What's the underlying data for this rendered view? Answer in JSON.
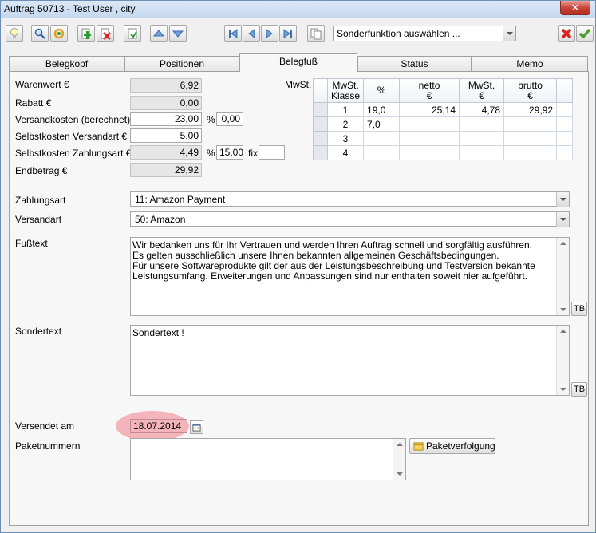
{
  "window": {
    "title": "Auftrag 50713 - Test User , city",
    "close_glyph": "✕"
  },
  "toolbar": {
    "sonderfunktion": "Sonderfunktion auswählen ...",
    "icons": [
      "bulb-icon",
      "search-icon",
      "refresh-icon",
      "add-icon",
      "delete-icon",
      "export-icon",
      "up-icon",
      "down-icon",
      "first-icon",
      "prev-icon",
      "next-icon",
      "last-icon",
      "copy-icon",
      "cancel-icon",
      "ok-icon"
    ]
  },
  "tabs": [
    "Belegkopf",
    "Positionen",
    "Belegfuß",
    "Status",
    "Memo"
  ],
  "active_tab": "Belegfuß",
  "amounts": {
    "warenwert_label": "Warenwert €",
    "warenwert": "6,92",
    "rabatt_label": "Rabatt €",
    "rabatt": "0,00",
    "versandkosten_label": "Versandkosten (berechnet) €",
    "versandkosten": "23,00",
    "versand_pct_label": "%",
    "versand_pct": "0,00",
    "selbst_versand_label": "Selbstkosten Versandart €",
    "selbst_versand": "5,00",
    "selbst_zahlung_label": "Selbstkosten Zahlungsart €",
    "selbst_zahlung": "4,49",
    "zahlung_pct_label": "%",
    "zahlung_pct": "15,00",
    "fix_label": "fix",
    "fix_value": "",
    "endbetrag_label": "Endbetrag €",
    "endbetrag": "29,92"
  },
  "mwst": {
    "label": "MwSt.",
    "headers": [
      {
        "line1": "MwSt.",
        "line2": "Klasse"
      },
      {
        "line1": "%",
        "line2": ""
      },
      {
        "line1": "netto",
        "line2": "€"
      },
      {
        "line1": "MwSt.",
        "line2": "€"
      },
      {
        "line1": "brutto",
        "line2": "€"
      }
    ],
    "rows": [
      {
        "klasse": "1",
        "pct": "19,0",
        "netto": "25,14",
        "mwst": "4,78",
        "brutto": "29,92"
      },
      {
        "klasse": "2",
        "pct": "7,0",
        "netto": "",
        "mwst": "",
        "brutto": ""
      },
      {
        "klasse": "3",
        "pct": "",
        "netto": "",
        "mwst": "",
        "brutto": ""
      },
      {
        "klasse": "4",
        "pct": "",
        "netto": "",
        "mwst": "",
        "brutto": ""
      }
    ]
  },
  "zahlungsart": {
    "label": "Zahlungsart",
    "value": "11: Amazon Payment"
  },
  "versandart": {
    "label": "Versandart",
    "value": "50: Amazon"
  },
  "fusstext": {
    "label": "Fußtext",
    "lines": [
      "Wir bedanken uns für Ihr Vertrauen und werden Ihren Auftrag schnell und sorgfältig ausführen.",
      "Es gelten ausschließlich unsere Ihnen bekannten allgemeinen Geschäftsbedingungen.",
      "Für unsere Softwareprodukte gilt der aus der Leistungsbeschreibung und Testversion bekannte",
      "Leistungsumfang. Erweiterungen und Anpassungen sind nur enthalten soweit hier aufgeführt."
    ],
    "tb": "TB"
  },
  "sondertext": {
    "label": "Sondertext",
    "value": "Sondertext !",
    "tb": "TB"
  },
  "versendet": {
    "label": "Versendet am",
    "value": "18.07.2014"
  },
  "paket": {
    "label": "Paketnummern",
    "value": "",
    "button": "Paketverfolgung"
  },
  "colors": {
    "highlight": "#f2a2ab",
    "frame": "#6d8fb4"
  }
}
